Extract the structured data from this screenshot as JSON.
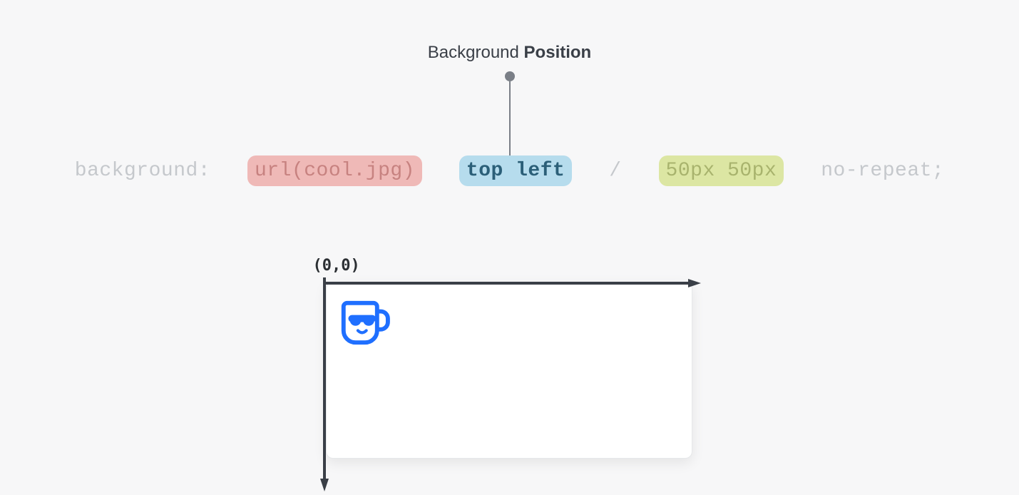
{
  "title": {
    "prefix": "Background ",
    "bold": "Position"
  },
  "code": {
    "prop": "background:",
    "url": "url(cool.jpg)",
    "position": "top left",
    "sep": "/",
    "size": "50px 50px",
    "repeat": "no-repeat;"
  },
  "origin_label": "(0,0)",
  "icons": {
    "mug": "mug-icon"
  },
  "colors": {
    "highlight_url": "#efb9b7",
    "highlight_pos": "#b6dced",
    "highlight_size": "#dce6a3",
    "accent": "#1f6fff",
    "axis": "#3a3f47"
  }
}
